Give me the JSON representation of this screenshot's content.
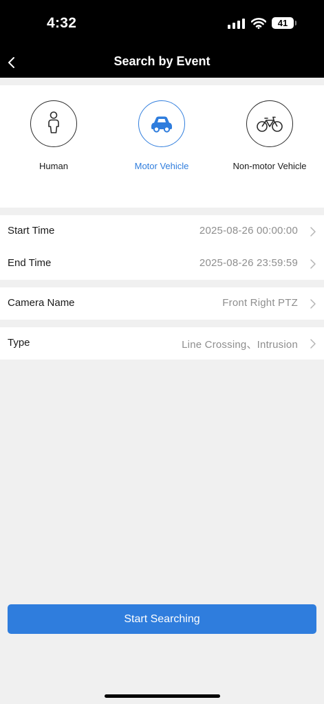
{
  "status_bar": {
    "time": "4:32",
    "battery": "41"
  },
  "nav": {
    "title": "Search by Event",
    "back_icon": "chevron-left-icon"
  },
  "categories": [
    {
      "label": "Human",
      "icon": "person-icon",
      "selected": false
    },
    {
      "label": "Motor Vehicle",
      "icon": "car-icon",
      "selected": true
    },
    {
      "label": "Non-motor Vehicle",
      "icon": "bicycle-icon",
      "selected": false
    }
  ],
  "time_group": {
    "start": {
      "label": "Start Time",
      "value": "2025-08-26 00:00:00"
    },
    "end": {
      "label": "End Time",
      "value": "2025-08-26 23:59:59"
    }
  },
  "camera": {
    "label": "Camera Name",
    "value": "Front Right PTZ"
  },
  "type": {
    "label": "Type",
    "value": "Line Crossing、Intrusion"
  },
  "action": {
    "label": "Start Searching"
  },
  "colors": {
    "accent": "#2f7ddd",
    "header": "#000000",
    "background": "#f0f0f0",
    "value_text": "#8e8e8e"
  }
}
